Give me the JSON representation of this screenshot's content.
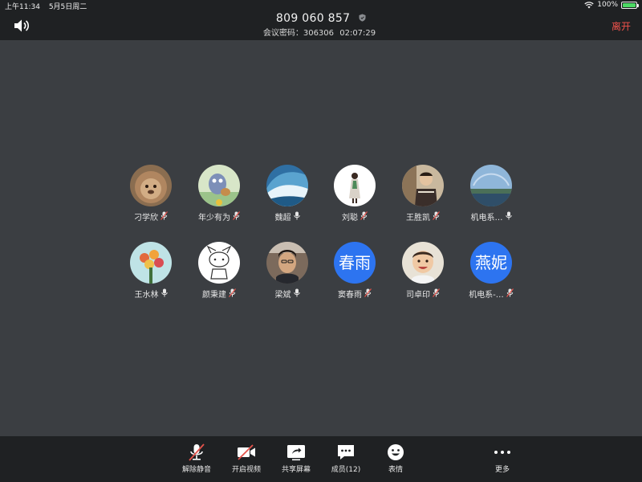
{
  "status_bar": {
    "time": "上午11:34",
    "date": "5月5日周二",
    "battery_text": "100%",
    "battery_level": 1.0
  },
  "header": {
    "meeting_id": "809 060 857",
    "password_label": "会议密码：",
    "password": "306306",
    "duration": "02:07:29",
    "leave_label": "离开",
    "leave_color": "#f2524b"
  },
  "participants": [
    {
      "name": "刁学欣",
      "avatar_kind": "photo-lion",
      "mic": "muted"
    },
    {
      "name": "年少有为",
      "avatar_kind": "photo-cartoon",
      "mic": "muted"
    },
    {
      "name": "魏超",
      "avatar_kind": "photo-wave",
      "mic": "on"
    },
    {
      "name": "刘聪",
      "avatar_kind": "photo-girl",
      "mic": "muted"
    },
    {
      "name": "王胜凯",
      "avatar_kind": "photo-child",
      "mic": "muted"
    },
    {
      "name": "机电系…",
      "avatar_kind": "photo-landscape",
      "mic": "on"
    },
    {
      "name": "王水林",
      "avatar_kind": "photo-flowers",
      "mic": "on"
    },
    {
      "name": "颜秉建",
      "avatar_kind": "photo-sketch",
      "mic": "muted"
    },
    {
      "name": "梁斌",
      "avatar_kind": "photo-man",
      "mic": "on"
    },
    {
      "name": "窦春雨",
      "avatar_text": "春雨",
      "mic": "muted"
    },
    {
      "name": "司卓印",
      "avatar_kind": "photo-baby",
      "mic": "muted"
    },
    {
      "name": "机电系-…",
      "avatar_text": "燕妮",
      "mic": "muted"
    }
  ],
  "toolbar": {
    "unmute": "解除静音",
    "start_video": "开启视频",
    "share_screen": "共享屏幕",
    "members": "成员(12)",
    "emoji": "表情",
    "more": "更多"
  },
  "colors": {
    "background": "#3b3e42",
    "bars": "#1f2123",
    "text_avatar": "#2d74f0",
    "muted_red": "#e5534b"
  }
}
